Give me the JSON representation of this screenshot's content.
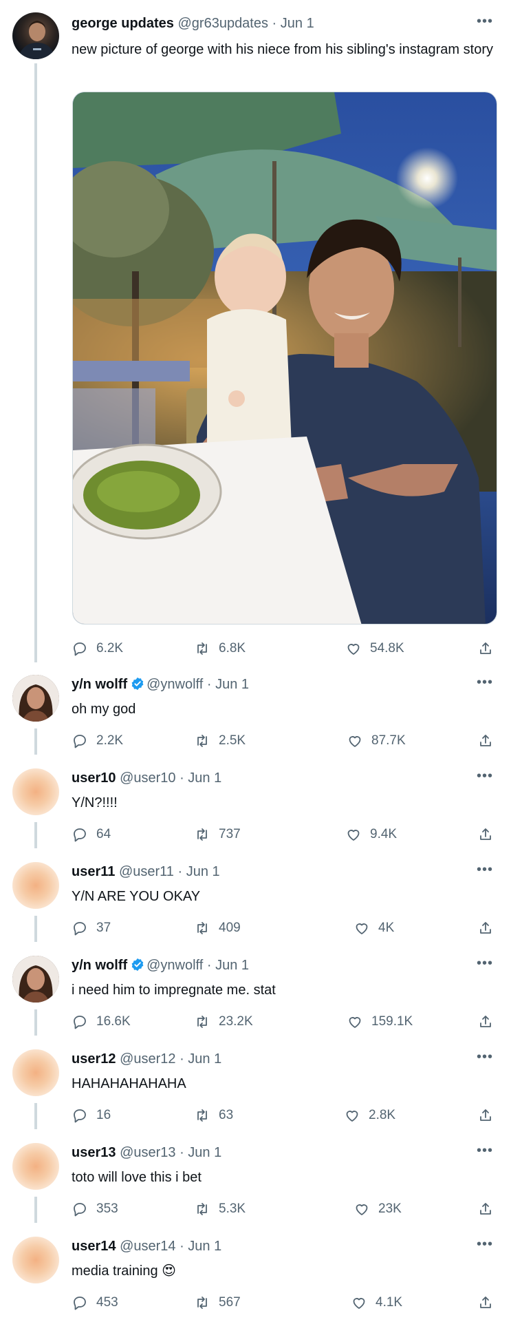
{
  "tweets": [
    {
      "name": "george updates",
      "verified": false,
      "handle": "@gr63updates · Jun 1",
      "text": "new picture of george with his niece from his sibling's instagram story",
      "stats": {
        "replies": "6.2K",
        "retweets": "6.8K",
        "likes": "54.8K"
      }
    },
    {
      "name": "y/n wolff",
      "verified": true,
      "handle": "@ynwolff · Jun 1",
      "text": "oh my god",
      "stats": {
        "replies": "2.2K",
        "retweets": "2.5K",
        "likes": "87.7K"
      }
    },
    {
      "name": "user10",
      "verified": false,
      "handle": "@user10 · Jun 1",
      "text": "Y/N?!!!!",
      "stats": {
        "replies": "64",
        "retweets": "737",
        "likes": "9.4K"
      }
    },
    {
      "name": "user11",
      "verified": false,
      "handle": "@user11 · Jun 1",
      "text": "Y/N ARE YOU OKAY",
      "stats": {
        "replies": "37",
        "retweets": "409",
        "likes": "4K"
      }
    },
    {
      "name": "y/n wolff",
      "verified": true,
      "handle": "@ynwolff · Jun 1",
      "text": "i need him to impregnate me. stat",
      "stats": {
        "replies": "16.6K",
        "retweets": "23.2K",
        "likes": "159.1K"
      }
    },
    {
      "name": "user12",
      "verified": false,
      "handle": "@user12 · Jun 1",
      "text": "HAHAHAHAHAHA",
      "stats": {
        "replies": "16",
        "retweets": "63",
        "likes": "2.8K"
      }
    },
    {
      "name": "user13",
      "verified": false,
      "handle": "@user13 · Jun 1",
      "text": "toto will love this i bet",
      "stats": {
        "replies": "353",
        "retweets": "5.3K",
        "likes": "23K"
      }
    },
    {
      "name": "user14",
      "verified": false,
      "handle": "@user14 · Jun 1",
      "text": "media training 😍",
      "stats": {
        "replies": "453",
        "retweets": "567",
        "likes": "4.1K"
      }
    }
  ],
  "more_label": "•••",
  "colors": {
    "text": "#0f1419",
    "secondary": "#536471",
    "verified": "#1d9bf0",
    "thread_line": "#cfd9de"
  },
  "icons": {
    "reply": "reply-icon",
    "retweet": "retweet-icon",
    "like": "heart-icon",
    "share": "share-icon",
    "more": "more-icon",
    "verified": "verified-badge-icon"
  }
}
